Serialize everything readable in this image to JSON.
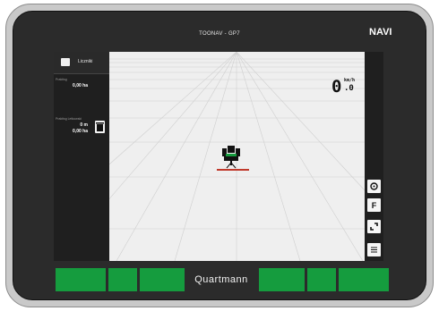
{
  "device": {
    "title": "TOONAV - GP7",
    "mode": "NAVI",
    "brand": "Quartmann"
  },
  "left_panel": {
    "title": "Liczniki",
    "area_label": "Praktisg",
    "area_value": "0,00 ha",
    "worked_label": "Praktisg Letkowski",
    "distance_value": "0 m",
    "worked_value": "0,00 ha"
  },
  "speed": {
    "integer": "0",
    "unit": "km/h",
    "decimal": ".0"
  },
  "right_buttons": [
    "settings-icon",
    "F",
    "frame-icon",
    "list-icon"
  ],
  "sections": [
    "1",
    "1",
    "1"
  ],
  "colors": {
    "bar_green": "#159c3e",
    "implement_red": "#c0392b",
    "panel_dark": "#1f1f1f",
    "bezel": "#2b2b2b"
  }
}
